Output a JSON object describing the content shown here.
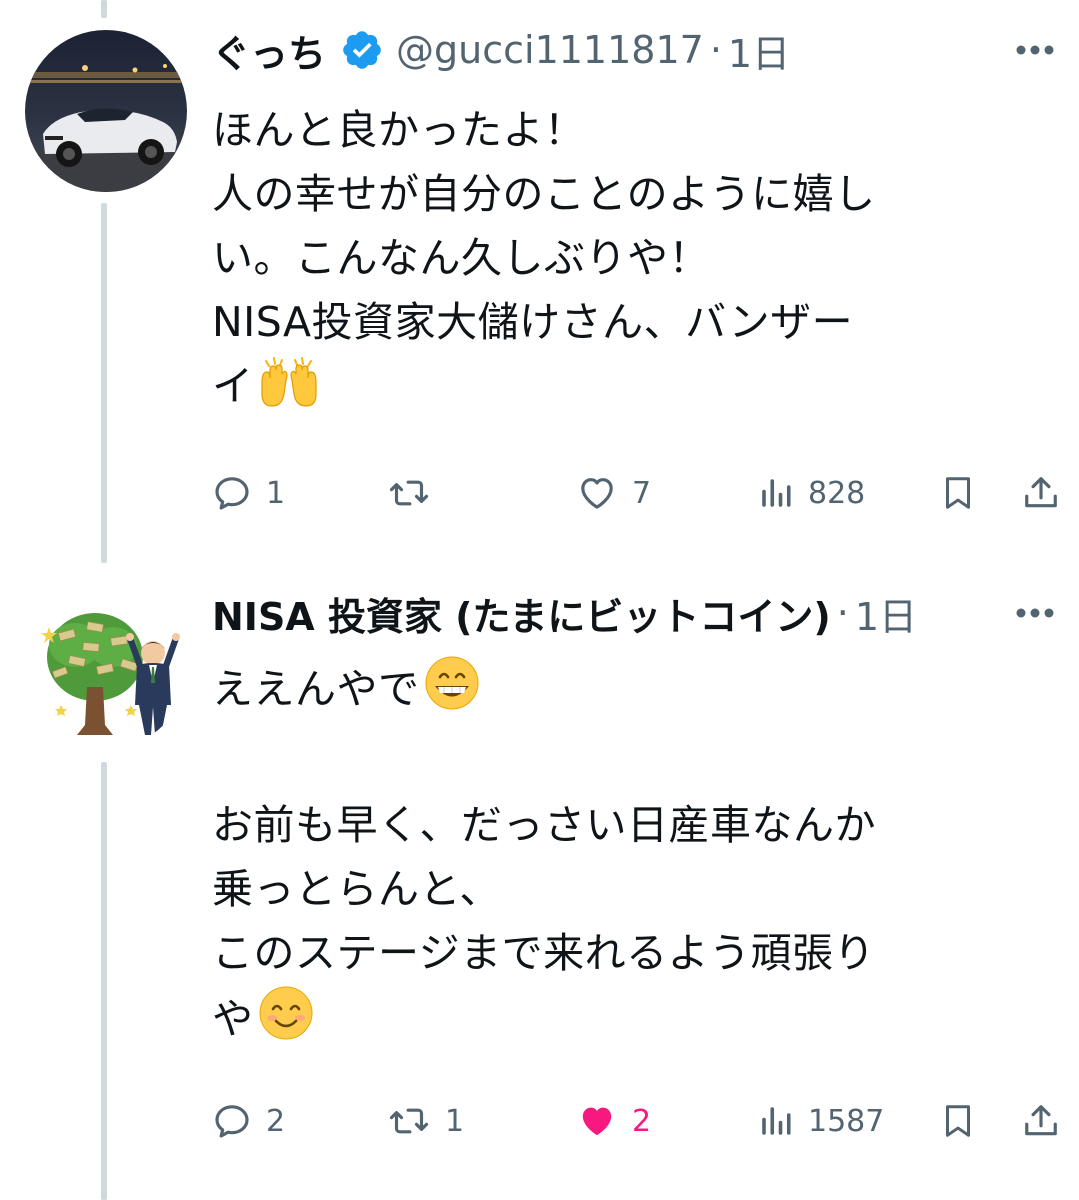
{
  "tweets": [
    {
      "display_name": "ぐっち",
      "verified": true,
      "handle": "@gucci1111817",
      "separator": "·",
      "time": "1日",
      "lines": [
        "ほんと良かったよ！",
        "人の幸せが自分のことのように嬉し",
        "い。こんなん久しぶりや！",
        "NISA投資家大儲けさん、バンザー",
        "イ"
      ],
      "emoji": "raising-hands",
      "actions": {
        "replies": "1",
        "retweets": "",
        "likes": "7",
        "views": "828",
        "liked": false
      }
    },
    {
      "display_name": "NISA 投資家 (たまにビットコイン)",
      "verified": false,
      "handle": "",
      "separator": "·",
      "time": "1日",
      "lines": [
        "ええんやで",
        "",
        "お前も早く、だっさい日産車なんか",
        "乗っとらんと、",
        "このステージまで来れるよう頑張り",
        "や"
      ],
      "emoji_line1": "grinning-face",
      "emoji_last": "smiling-face",
      "actions": {
        "replies": "2",
        "retweets": "1",
        "likes": "2",
        "views": "1587",
        "liked": true
      }
    }
  ],
  "colors": {
    "text": "#0f1419",
    "secondary": "#536471",
    "thread_line": "#cfd9de",
    "verified": "#1d9bf0",
    "like": "#f91880"
  }
}
